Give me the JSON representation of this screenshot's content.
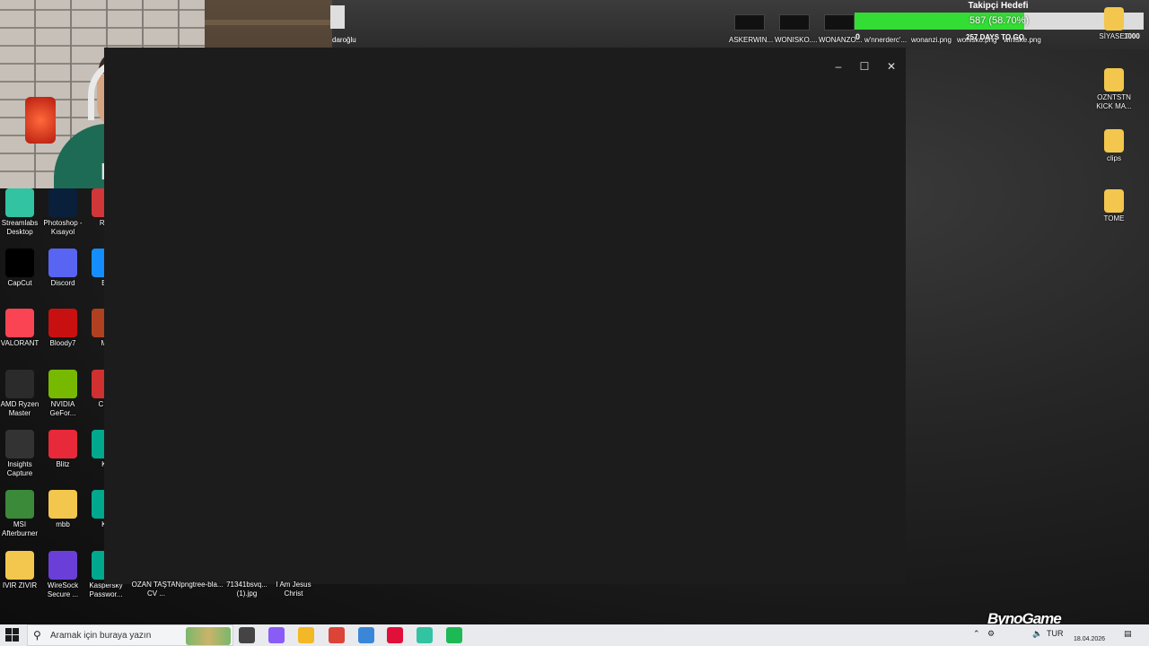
{
  "overlay": {
    "follower_goal": {
      "title": "Takipçi Hedefi",
      "progress_text": "587 (58.70%)",
      "current": 587,
      "target": 1000,
      "fraction": 0.587,
      "min_label": "0",
      "max_label": "1000",
      "subtitle": "257 DAYS TO GO",
      "fill_color": "#33dd33"
    },
    "watermark": "BynoGame"
  },
  "top_strip": {
    "partial_label": "daroğlu",
    "thumbs": [
      "ASKERWIN...",
      "WONISKO....",
      "WONANZO..."
    ],
    "files": [
      "w'nnerderc'...",
      "wonanzi.png",
      "wonisko.png",
      "winiske.png"
    ]
  },
  "desktop_left": [
    {
      "label": "Streamlabs Desktop",
      "icon": "streamlabs-icon",
      "color": "#31c3a2"
    },
    {
      "label": "Photoshop - Kısayol",
      "icon": "photoshop-icon",
      "color": "#0a1f3a"
    },
    {
      "label": "Riot",
      "icon": "riot-icon",
      "color": "#d13639"
    },
    {
      "label": "CapCut",
      "icon": "capcut-icon",
      "color": "#000000"
    },
    {
      "label": "Discord",
      "icon": "discord-icon",
      "color": "#5865f2"
    },
    {
      "label": "Ba",
      "icon": "battlenet-icon",
      "color": "#148eff"
    },
    {
      "label": "VALORANT",
      "icon": "valorant-icon",
      "color": "#fa4454"
    },
    {
      "label": "Bloody7",
      "icon": "bloody-icon",
      "color": "#c91010"
    },
    {
      "label": "Me",
      "icon": "generic-app-icon",
      "color": "#b04020"
    },
    {
      "label": "AMD Ryzen Master",
      "icon": "ryzen-icon",
      "color": "#2b2b2b"
    },
    {
      "label": "NVIDIA GeFor...",
      "icon": "nvidia-icon",
      "color": "#76b900"
    },
    {
      "label": "CPU",
      "icon": "cpu-icon",
      "color": "#d03030"
    },
    {
      "label": "Insights Capture",
      "icon": "insights-icon",
      "color": "#333333"
    },
    {
      "label": "Blitz",
      "icon": "blitz-icon",
      "color": "#e8293a"
    },
    {
      "label": "Ka",
      "icon": "kaspersky-icon",
      "color": "#00a88e"
    },
    {
      "label": "MSI Afterburner",
      "icon": "msi-icon",
      "color": "#3a8a3a"
    },
    {
      "label": "mbb",
      "icon": "folder-icon",
      "color": "#f3c74d"
    },
    {
      "label": "Ka",
      "icon": "kaspersky-icon",
      "color": "#00a88e"
    },
    {
      "label": "IVIR ZIVIR",
      "icon": "folder-icon",
      "color": "#f3c74d"
    },
    {
      "label": "WireSock Secure ...",
      "icon": "wiresock-icon",
      "color": "#6a3fd8"
    },
    {
      "label": "Kaspersky Passwor...",
      "icon": "kaspersky-icon",
      "color": "#00a88e"
    }
  ],
  "desktop_bottom": [
    "OZAN TAŞTAN CV ...",
    "pngtree-bla...",
    "71341bsvq... (1).jpg",
    "I Am Jesus Christ"
  ],
  "desktop_right": [
    {
      "label": "SİYASET",
      "icon": "folder-icon"
    },
    {
      "label": "OZNTSTN KICK MA...",
      "icon": "folder-icon"
    },
    {
      "label": "clips",
      "icon": "folder-icon"
    },
    {
      "label": "TOME",
      "icon": "folder-icon"
    }
  ],
  "window": {
    "minimize": "–",
    "maximize": "☐",
    "close": "✕"
  },
  "taskbar": {
    "search_placeholder": "Aramak için buraya yazın",
    "apps": [
      {
        "icon": "task-view-icon",
        "color": "#444444"
      },
      {
        "icon": "copilot-icon",
        "color": "#8a5cf6"
      },
      {
        "icon": "file-explorer-icon",
        "color": "#f2b825"
      },
      {
        "icon": "chrome-icon",
        "color": "#db4437"
      },
      {
        "icon": "brush-icon",
        "color": "#3a86d8"
      },
      {
        "icon": "record-icon",
        "color": "#e0103a"
      },
      {
        "icon": "streamlabs-icon",
        "color": "#31c3a2"
      },
      {
        "icon": "spotify-icon",
        "color": "#1db954"
      }
    ],
    "language": "TUR",
    "date": "18.04.2026"
  }
}
